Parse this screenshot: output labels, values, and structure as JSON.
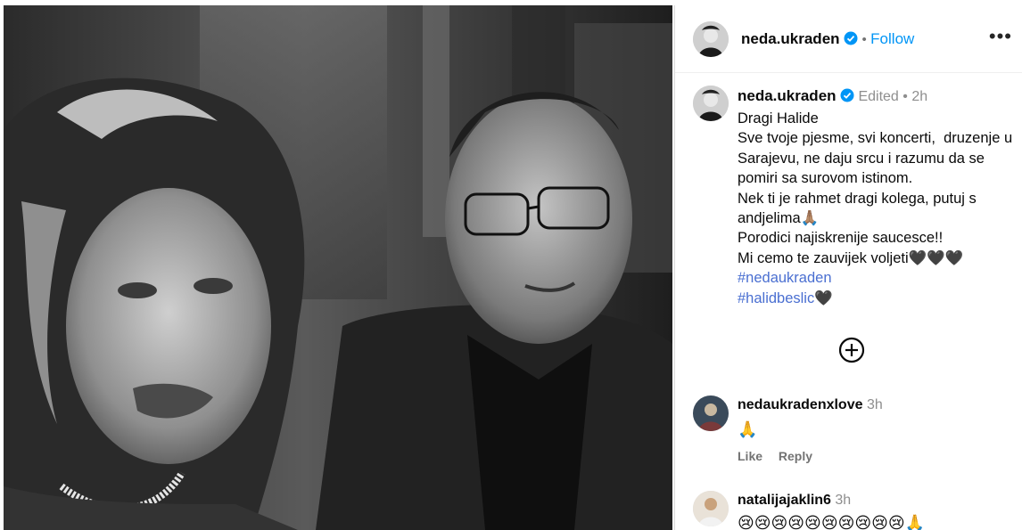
{
  "post": {
    "author": "neda.ukraden",
    "follow_label": "Follow",
    "more_icon": "more-horizontal-icon",
    "caption": {
      "author": "neda.ukraden",
      "edited": "Edited",
      "time": "2h",
      "lines": [
        "Dragi Halide",
        "Sve tvoje pjesme, svi koncerti,  druzenje u Sarajevu, ne daju srcu i razumu da se pomiri sa surovom istinom.",
        "Nek ti je rahmet dragi kolega, putuj s andjelima🙏🏽",
        "Porodici najiskrenije saucesce!!",
        "Mi cemo te zauvijek voljeti🖤🖤🖤"
      ],
      "hashtags": [
        "#nedaukraden",
        "#halidbeslic"
      ],
      "hashtag_suffix": "🖤"
    },
    "load_more_icon": "plus-circle-icon"
  },
  "comments": [
    {
      "username": "nedaukradenxlove",
      "time": "3h",
      "text": "🙏",
      "like_label": "Like",
      "reply_label": "Reply"
    },
    {
      "username": "natalijajaklin6",
      "time": "3h",
      "text": "😢😢😢😢😢😢😢😢😢😢🙏"
    }
  ],
  "colors": {
    "link_blue": "#0095f6",
    "hashtag_blue": "#4a6fd1",
    "verified_blue": "#0095f6",
    "muted_gray": "#8e8e8e"
  }
}
